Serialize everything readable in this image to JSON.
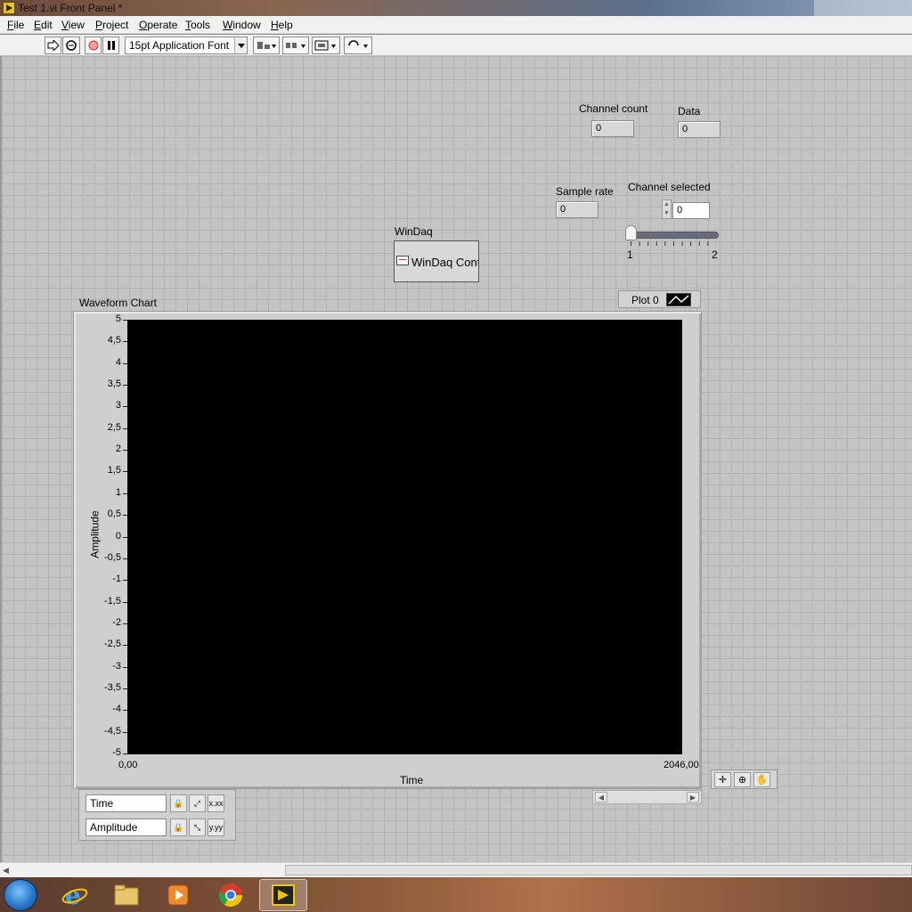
{
  "window": {
    "title": "Test 1.vi Front Panel *"
  },
  "menu": {
    "items": [
      "File",
      "Edit",
      "View",
      "Project",
      "Operate",
      "Tools",
      "Window",
      "Help"
    ]
  },
  "toolbar": {
    "font": "15pt Application Font",
    "icons": [
      "run-arrow-icon",
      "run-continuously-icon",
      "abort-icon",
      "pause-icon",
      "align-objects-icon",
      "distribute-objects-icon",
      "resize-objects-icon",
      "reorder-icon"
    ]
  },
  "panel": {
    "channel_count": {
      "label": "Channel count",
      "value": "0"
    },
    "data": {
      "label": "Data",
      "value": "0"
    },
    "sample_rate": {
      "label": "Sample rate",
      "value": "0"
    },
    "channel_selected": {
      "label": "Channel selected",
      "value": "0",
      "slider_min": "1",
      "slider_max": "2",
      "slider_value": 1
    },
    "windaq": {
      "label": "WinDaq",
      "control_text": "WinDaq Contr"
    }
  },
  "chart_data": {
    "type": "line",
    "title": "Waveform Chart",
    "xlabel": "Time",
    "ylabel": "Amplitude",
    "xlim": [
      0,
      2046
    ],
    "ylim": [
      -5,
      5
    ],
    "x_tick_labels": [
      "0,00",
      "2046,00"
    ],
    "y_tick_labels": [
      "5",
      "4,5",
      "4",
      "3,5",
      "3",
      "2,5",
      "2",
      "1,5",
      "1",
      "0,5",
      "0",
      "-0,5",
      "-1",
      "-1,5",
      "-2",
      "-2,5",
      "-3",
      "-3,5",
      "-4",
      "-4,5",
      "-5"
    ],
    "series": [
      {
        "name": "Plot 0",
        "values": []
      }
    ],
    "grid": false,
    "legend": "top-right",
    "background": "#000000"
  },
  "scale_legend": {
    "x_name": "Time",
    "y_name": "Amplitude"
  },
  "taskbar": {
    "apps": [
      "internet-explorer-icon",
      "file-explorer-icon",
      "media-player-icon",
      "chrome-icon",
      "labview-icon"
    ]
  }
}
